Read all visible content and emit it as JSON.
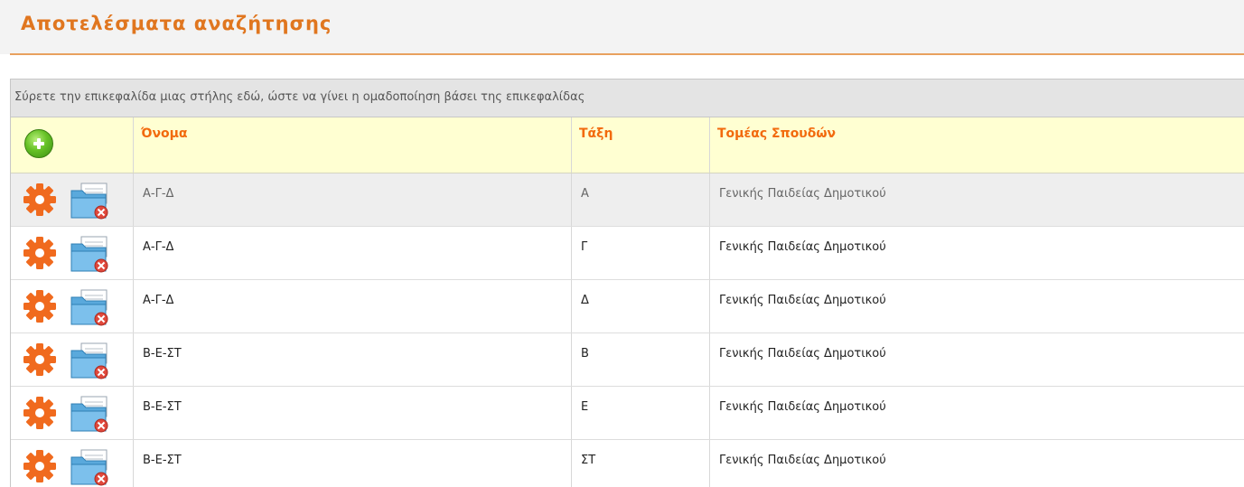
{
  "page": {
    "title": "Αποτελέσματα αναζήτησης"
  },
  "grid": {
    "group_hint": "Σύρετε την επικεφαλίδα μιας στήλης εδώ, ώστε να γίνει η ομαδοποίηση βάσει της επικεφαλίδας",
    "columns": [
      {
        "key": "actions",
        "label": "",
        "icon": "add-icon"
      },
      {
        "key": "name",
        "label": "Όνομα"
      },
      {
        "key": "class",
        "label": "Τάξη"
      },
      {
        "key": "sector",
        "label": "Τομέας Σπουδών"
      }
    ],
    "rows": [
      {
        "name": "Α-Γ-Δ",
        "class": "Α",
        "sector": "Γενικής Παιδείας Δημοτικού",
        "selected": true
      },
      {
        "name": "Α-Γ-Δ",
        "class": "Γ",
        "sector": "Γενικής Παιδείας Δημοτικού",
        "selected": false
      },
      {
        "name": "Α-Γ-Δ",
        "class": "Δ",
        "sector": "Γενικής Παιδείας Δημοτικού",
        "selected": false
      },
      {
        "name": "Β-Ε-ΣΤ",
        "class": "Β",
        "sector": "Γενικής Παιδείας Δημοτικού",
        "selected": false
      },
      {
        "name": "Β-Ε-ΣΤ",
        "class": "Ε",
        "sector": "Γενικής Παιδείας Δημοτικού",
        "selected": false
      },
      {
        "name": "Β-Ε-ΣΤ",
        "class": "ΣΤ",
        "sector": "Γενικής Παιδείας Δημοτικού",
        "selected": false
      }
    ],
    "row_icons": [
      "gear-icon",
      "delete-folder-icon"
    ]
  },
  "colors": {
    "title": "#e0761f",
    "header_bg": "#ffffd2",
    "header_text": "#f26a0d",
    "gear": "#f06a1e",
    "selected_row": "#eeeeee"
  }
}
